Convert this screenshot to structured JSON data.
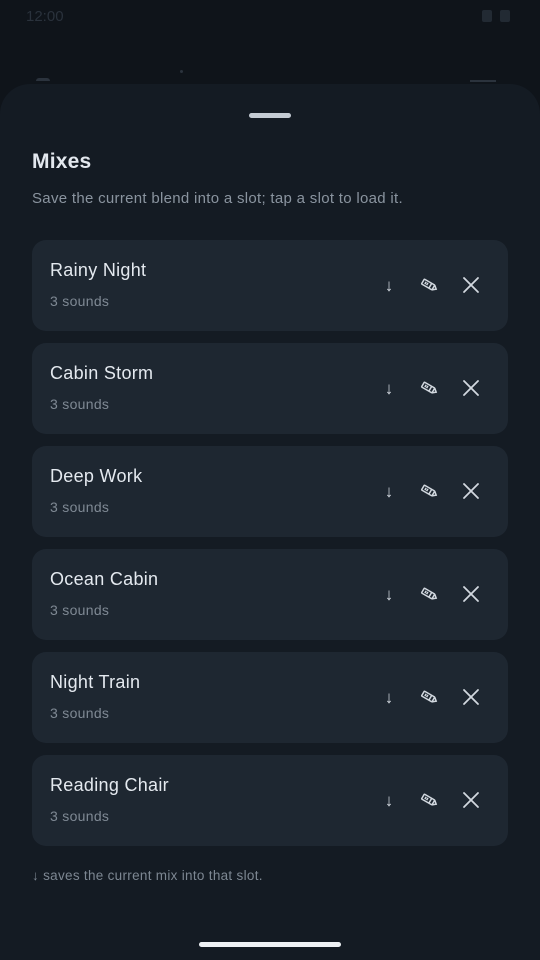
{
  "status_bar": {
    "time": "12:00"
  },
  "sheet": {
    "title": "Mixes",
    "subtitle": "Save the current blend into a slot; tap a slot to load it.",
    "footer_hint": "↓ saves the current mix into that slot."
  },
  "icons": {
    "save": "down-arrow-icon",
    "edit": "pencil-icon",
    "delete": "close-icon"
  },
  "mixes": [
    {
      "name": "Rainy Night",
      "count": "3 sounds"
    },
    {
      "name": "Cabin Storm",
      "count": "3 sounds"
    },
    {
      "name": "Deep Work",
      "count": "3 sounds"
    },
    {
      "name": "Ocean Cabin",
      "count": "3 sounds"
    },
    {
      "name": "Night Train",
      "count": "3 sounds"
    },
    {
      "name": "Reading Chair",
      "count": "3 sounds"
    }
  ],
  "colors": {
    "background": "#0d1116",
    "sheet": "#141b23",
    "card": "#1e2731",
    "text_primary": "#e4e9ef",
    "text_secondary": "#7f8994"
  }
}
